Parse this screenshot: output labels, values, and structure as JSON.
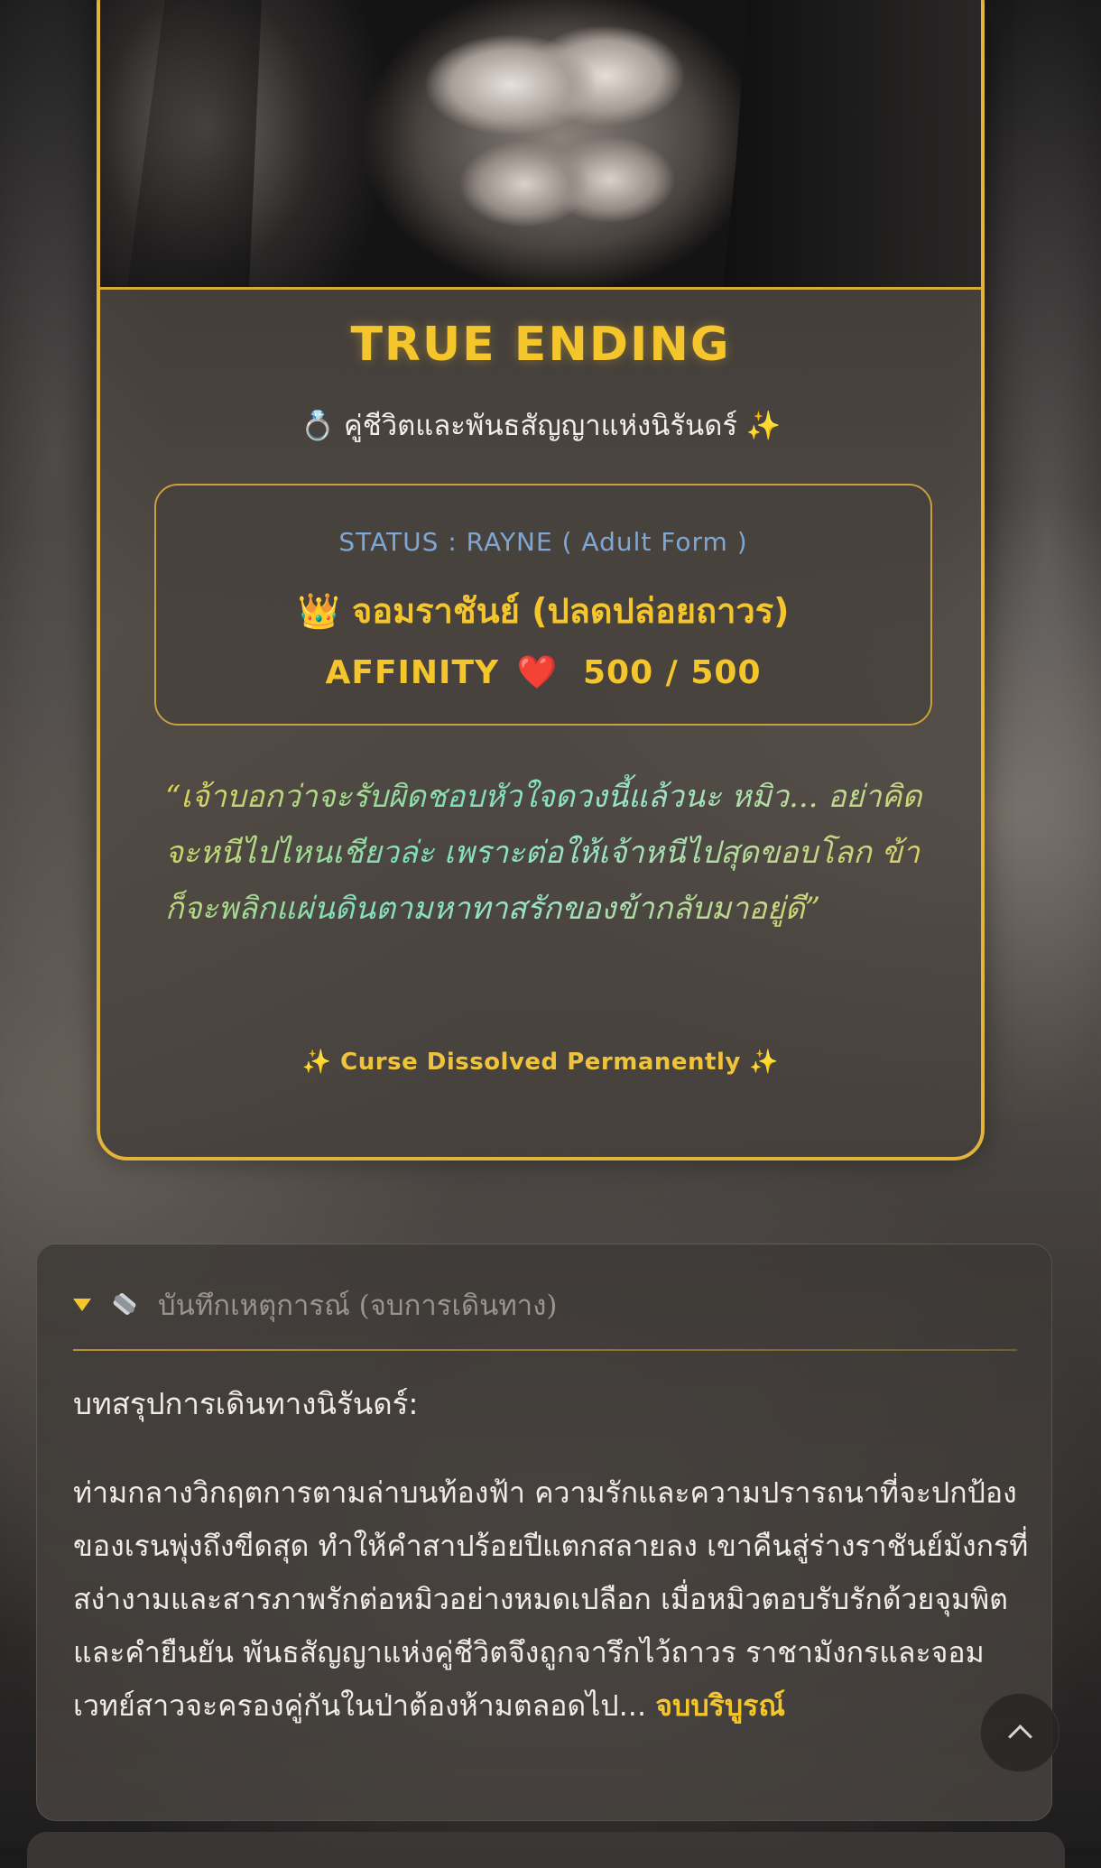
{
  "ending": {
    "title": "TRUE ENDING",
    "subtitle": "💍 คู่ชีวิตและพันธสัญญาแห่งนิรันดร์ ✨",
    "status": {
      "line": "STATUS : RAYNE ( Adult Form )",
      "title": "👑 จอมราชันย์ (ปลดปล่อยถาวร)",
      "affinity_label": "AFFINITY",
      "affinity_heart": "❤️",
      "affinity_value": "500 / 500"
    },
    "quote": "“เจ้าบอกว่าจะรับผิดชอบหัวใจดวงนี้แล้วนะ หมิว... อย่าคิดจะหนีไปไหนเชียวล่ะ เพราะต่อให้เจ้าหนีไปสุดขอบโลก ข้าก็จะพลิกแผ่นดินตามหาทาสรักของข้ากลับมาอยู่ดี”",
    "curse_line": "✨ Curse Dissolved Permanently ✨"
  },
  "log": {
    "header_label": "บันทึกเหตุการณ์ (จบการเดินทาง)",
    "heading": "บทสรุปการเดินทางนิรันดร์:",
    "body": "ท่ามกลางวิกฤตการตามล่าบนท้องฟ้า ความรักและความปรารถนาที่จะปกป้องของเรนพุ่งถึงขีดสุด ทำให้คำสาปร้อยปีแตกสลายลง เขาคืนสู่ร่างราชันย์มังกรที่สง่างามและสารภาพรักต่อหมิวอย่างหมดเปลือก เมื่อหมิวตอบรับรักด้วยจุมพิตและคำยืนยัน พันธสัญญาแห่งคู่ชีวิตจึงถูกจารึกไว้ถาวร ราชามังกรและจอมเวทย์สาวจะครองคู่กันในป่าต้องห้ามตลอดไป...",
    "end_mark": "จบบริบูรณ์"
  },
  "icons": {
    "caret": "caret-down-icon",
    "scroll": "scroll-icon",
    "scroll_top": "chevron-up-icon"
  },
  "colors": {
    "gold": "#f5c52c",
    "border_gold": "#e2b53a",
    "status_blue": "#7ea7d6",
    "heart_red": "#e63b3b"
  }
}
